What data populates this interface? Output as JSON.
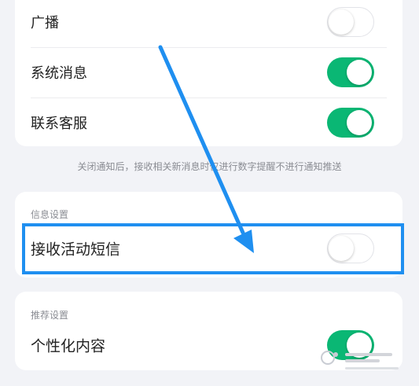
{
  "notifications": {
    "rows": [
      {
        "label": "广播",
        "enabled": false
      },
      {
        "label": "系统消息",
        "enabled": true
      },
      {
        "label": "联系客服",
        "enabled": true
      }
    ],
    "note": "关闭通知后，接收相关新消息时仅进行数字提醒不进行通知推送"
  },
  "info_settings": {
    "title": "信息设置",
    "rows": [
      {
        "label": "接收活动短信",
        "enabled": false
      }
    ]
  },
  "recommend_settings": {
    "title": "推荐设置",
    "rows": [
      {
        "label": "个性化内容",
        "enabled": true
      }
    ]
  },
  "colors": {
    "toggle_on": "#0ab774",
    "annotation_blue": "#1f8ff0",
    "background": "#f2f3f7"
  }
}
